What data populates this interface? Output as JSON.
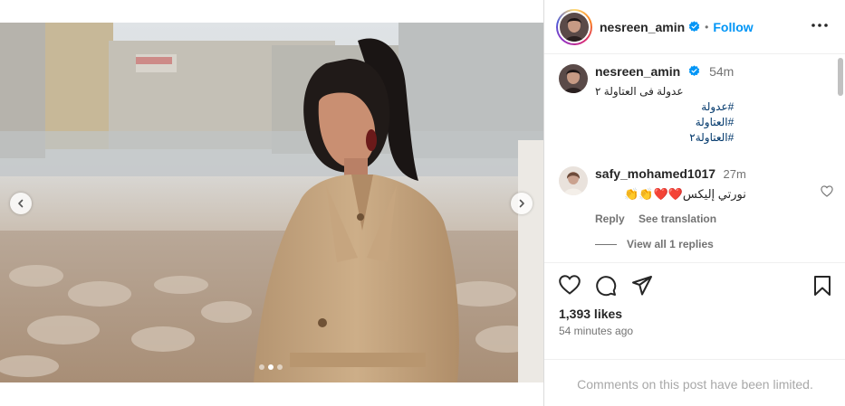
{
  "post": {
    "username": "nesreen_amin",
    "follow_label": "Follow",
    "separator": "•",
    "caption": {
      "time": "54m",
      "text": "عدولة فى العتاولة ٢",
      "hashtags": [
        "#عدولة",
        "#العتاولة",
        "#العتاولة٢"
      ]
    },
    "comment": {
      "username": "safy_mohamed1017",
      "time": "27m",
      "text": "نورتي إليكس❤️❤️👏👏",
      "reply_label": "Reply",
      "translate_label": "See translation"
    },
    "view_replies": "View all 1 replies",
    "likes": "1,393 likes",
    "posted_ago": "54 minutes ago",
    "comments_limited": "Comments on this post have been limited.",
    "carousel": {
      "slide_count": 3,
      "active_slide": 2
    }
  },
  "icons": {
    "header": [
      "verified-icon",
      "more-options-icon"
    ],
    "actions": [
      "heart-icon",
      "comment-icon",
      "share-icon",
      "bookmark-icon"
    ],
    "carousel": [
      "chevron-left-icon",
      "chevron-right-icon"
    ]
  },
  "colors": {
    "accent": "#0095f6",
    "hashtag": "#00376b",
    "muted": "#737373",
    "verified": "#0095f6"
  }
}
